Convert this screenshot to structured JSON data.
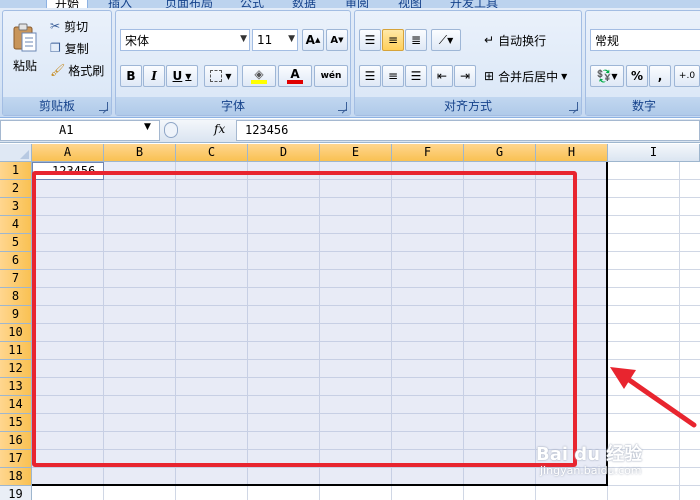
{
  "ribbon": {
    "tabs": [
      "开始",
      "插入",
      "页面布局",
      "公式",
      "数据",
      "审阅",
      "视图",
      "开发工具"
    ],
    "clipboard": {
      "paste": "粘贴",
      "cut": "剪切",
      "copy": "复制",
      "format_painter": "格式刷",
      "label": "剪贴板"
    },
    "font": {
      "name": "宋体",
      "size": "11",
      "bold": "B",
      "italic": "I",
      "underline": "U",
      "grow": "A",
      "shrink": "A",
      "wen": "wén",
      "label": "字体"
    },
    "alignment": {
      "wrap": "自动换行",
      "merge": "合并后居中",
      "label": "对齐方式"
    },
    "number": {
      "format": "常规",
      "percent": "%",
      "comma": ",",
      "inc_decimal": "+.0",
      "label": "数字"
    }
  },
  "formula_bar": {
    "name_box": "A1",
    "fx": "fx",
    "formula": "123456"
  },
  "sheet": {
    "columns": [
      "A",
      "B",
      "C",
      "D",
      "E",
      "F",
      "G",
      "H",
      "I"
    ],
    "rows": [
      "1",
      "2",
      "3",
      "4",
      "5",
      "6",
      "7",
      "8",
      "9",
      "10",
      "11",
      "12",
      "13",
      "14",
      "15",
      "16",
      "17",
      "18",
      "19"
    ],
    "cell_a1": "123456"
  },
  "watermark": {
    "main": "Bai du 经验",
    "sub": "jingyan.baidu.com"
  },
  "colors": {
    "selected_header": "#f9c152",
    "red_annotation": "#e8252f",
    "ribbon_bg": "#d6e4f5"
  }
}
